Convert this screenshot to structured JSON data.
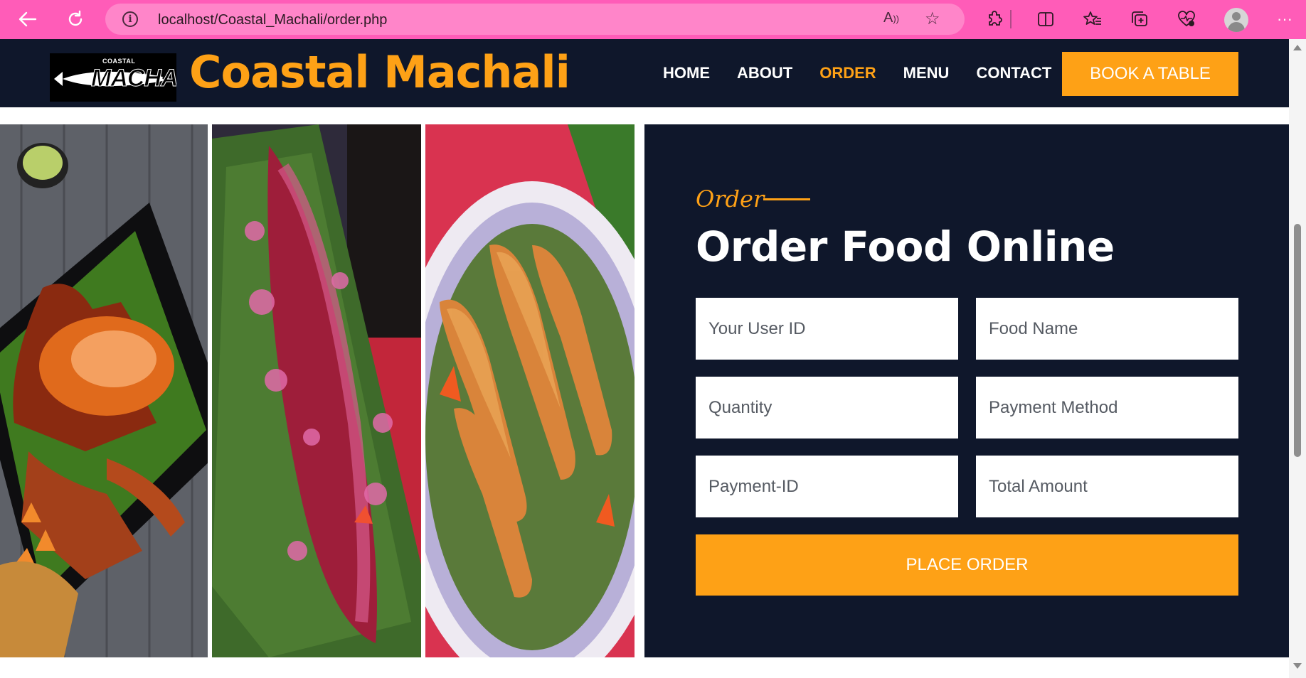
{
  "browser": {
    "url": "localhost/Coastal_Machali/order.php",
    "read_aloud_label": "A",
    "icons": {
      "back": "back-arrow-icon",
      "refresh": "refresh-icon",
      "info": "info-icon",
      "favorite": "star-icon",
      "extensions": "extensions-icon",
      "split_screen": "split-screen-icon",
      "favorites_list": "favorites-icon",
      "collections": "collections-icon",
      "browser_essentials": "heart-pulse-icon",
      "profile": "profile-avatar",
      "more": "more-icon"
    },
    "colors": {
      "chrome": "#ff5cb8",
      "urlbar": "#ff85c9"
    }
  },
  "site": {
    "logo": {
      "small_text": "COASTAL",
      "large_text": "MACHALI"
    },
    "brand_name": "Coastal Machali",
    "nav": {
      "items": [
        {
          "label": "HOME",
          "active": false
        },
        {
          "label": "ABOUT",
          "active": false
        },
        {
          "label": "ORDER",
          "active": true
        },
        {
          "label": "MENU",
          "active": false
        },
        {
          "label": "CONTACT",
          "active": false
        }
      ],
      "cta_label": "BOOK A TABLE"
    },
    "colors": {
      "primary": "#fea116",
      "dark": "#0f172b",
      "white": "#ffffff"
    }
  },
  "images": [
    {
      "alt": "crab-dish-image"
    },
    {
      "alt": "fish-platter-image"
    },
    {
      "alt": "prawns-dish-image"
    }
  ],
  "order_form": {
    "tagline": "Order",
    "title": "Order Food Online",
    "fields": {
      "user_id": {
        "placeholder": "Your User ID",
        "value": ""
      },
      "food_name": {
        "placeholder": "Food Name",
        "value": ""
      },
      "quantity": {
        "placeholder": "Quantity",
        "value": ""
      },
      "payment_method": {
        "placeholder": "Payment Method",
        "value": ""
      },
      "payment_id": {
        "placeholder": "Payment-ID",
        "value": ""
      },
      "total_amount": {
        "placeholder": "Total Amount",
        "value": ""
      }
    },
    "submit_label": "PLACE ORDER"
  }
}
